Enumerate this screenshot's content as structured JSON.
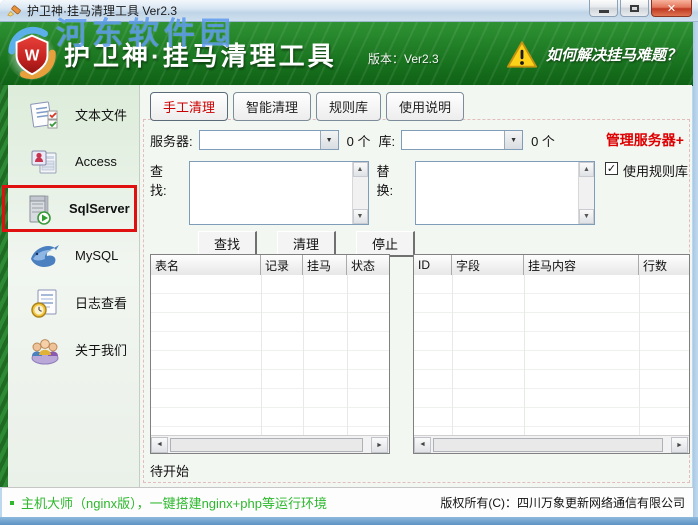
{
  "window": {
    "title": "护卫神·挂马清理工具 Ver2.3"
  },
  "watermark": "河东软件园",
  "header": {
    "title": "护卫神·挂马清理工具",
    "version": "版本：Ver2.3",
    "help": "如何解决挂马难题？"
  },
  "sidebar": {
    "items": [
      {
        "label": "文本文件",
        "icon": "text-file-icon",
        "selected": false
      },
      {
        "label": "Access",
        "icon": "access-icon",
        "selected": false
      },
      {
        "label": "SqlServer",
        "icon": "sqlserver-icon",
        "selected": true
      },
      {
        "label": "MySQL",
        "icon": "mysql-icon",
        "selected": false
      },
      {
        "label": "日志查看",
        "icon": "log-view-icon",
        "selected": false
      },
      {
        "label": "关于我们",
        "icon": "about-us-icon",
        "selected": false
      }
    ]
  },
  "tabs": [
    {
      "label": "手工清理",
      "active": true
    },
    {
      "label": "智能清理",
      "active": false
    },
    {
      "label": "规则库",
      "active": false
    },
    {
      "label": "使用说明",
      "active": false
    }
  ],
  "form": {
    "server_label": "服务器:",
    "server_value": "",
    "server_count": "0 个",
    "db_label": "库:",
    "db_value": "",
    "db_count": "0 个",
    "manage_link": "管理服务器+",
    "find_label": "查 找:",
    "find_value": "",
    "replace_label": "替 换:",
    "replace_value": "",
    "use_rules_label": "使用规则库",
    "use_rules_checked": true,
    "buttons": {
      "find": "查找",
      "clean": "清理",
      "stop": "停止"
    }
  },
  "tables": {
    "left": {
      "columns": [
        "表名",
        "记录",
        "挂马",
        "状态"
      ],
      "rows": []
    },
    "right": {
      "columns": [
        "ID",
        "字段",
        "挂马内容",
        "行数"
      ],
      "rows": []
    }
  },
  "status": "待开始",
  "footer": {
    "promo": "主机大师（nginx版），一键搭建nginx+php等运行环境",
    "copyright": "版权所有(C)：四川万象更新网络通信有限公司"
  },
  "icons": {
    "close": "✕",
    "dropdown": "▼",
    "up": "▲",
    "down": "▼",
    "left": "◄",
    "right": "►",
    "check": "✓",
    "warning": "!"
  },
  "colors": {
    "header_green": "#17701d",
    "accent_red": "#dd0000",
    "promo_green": "#2db82d",
    "selection_border": "#e01010"
  }
}
